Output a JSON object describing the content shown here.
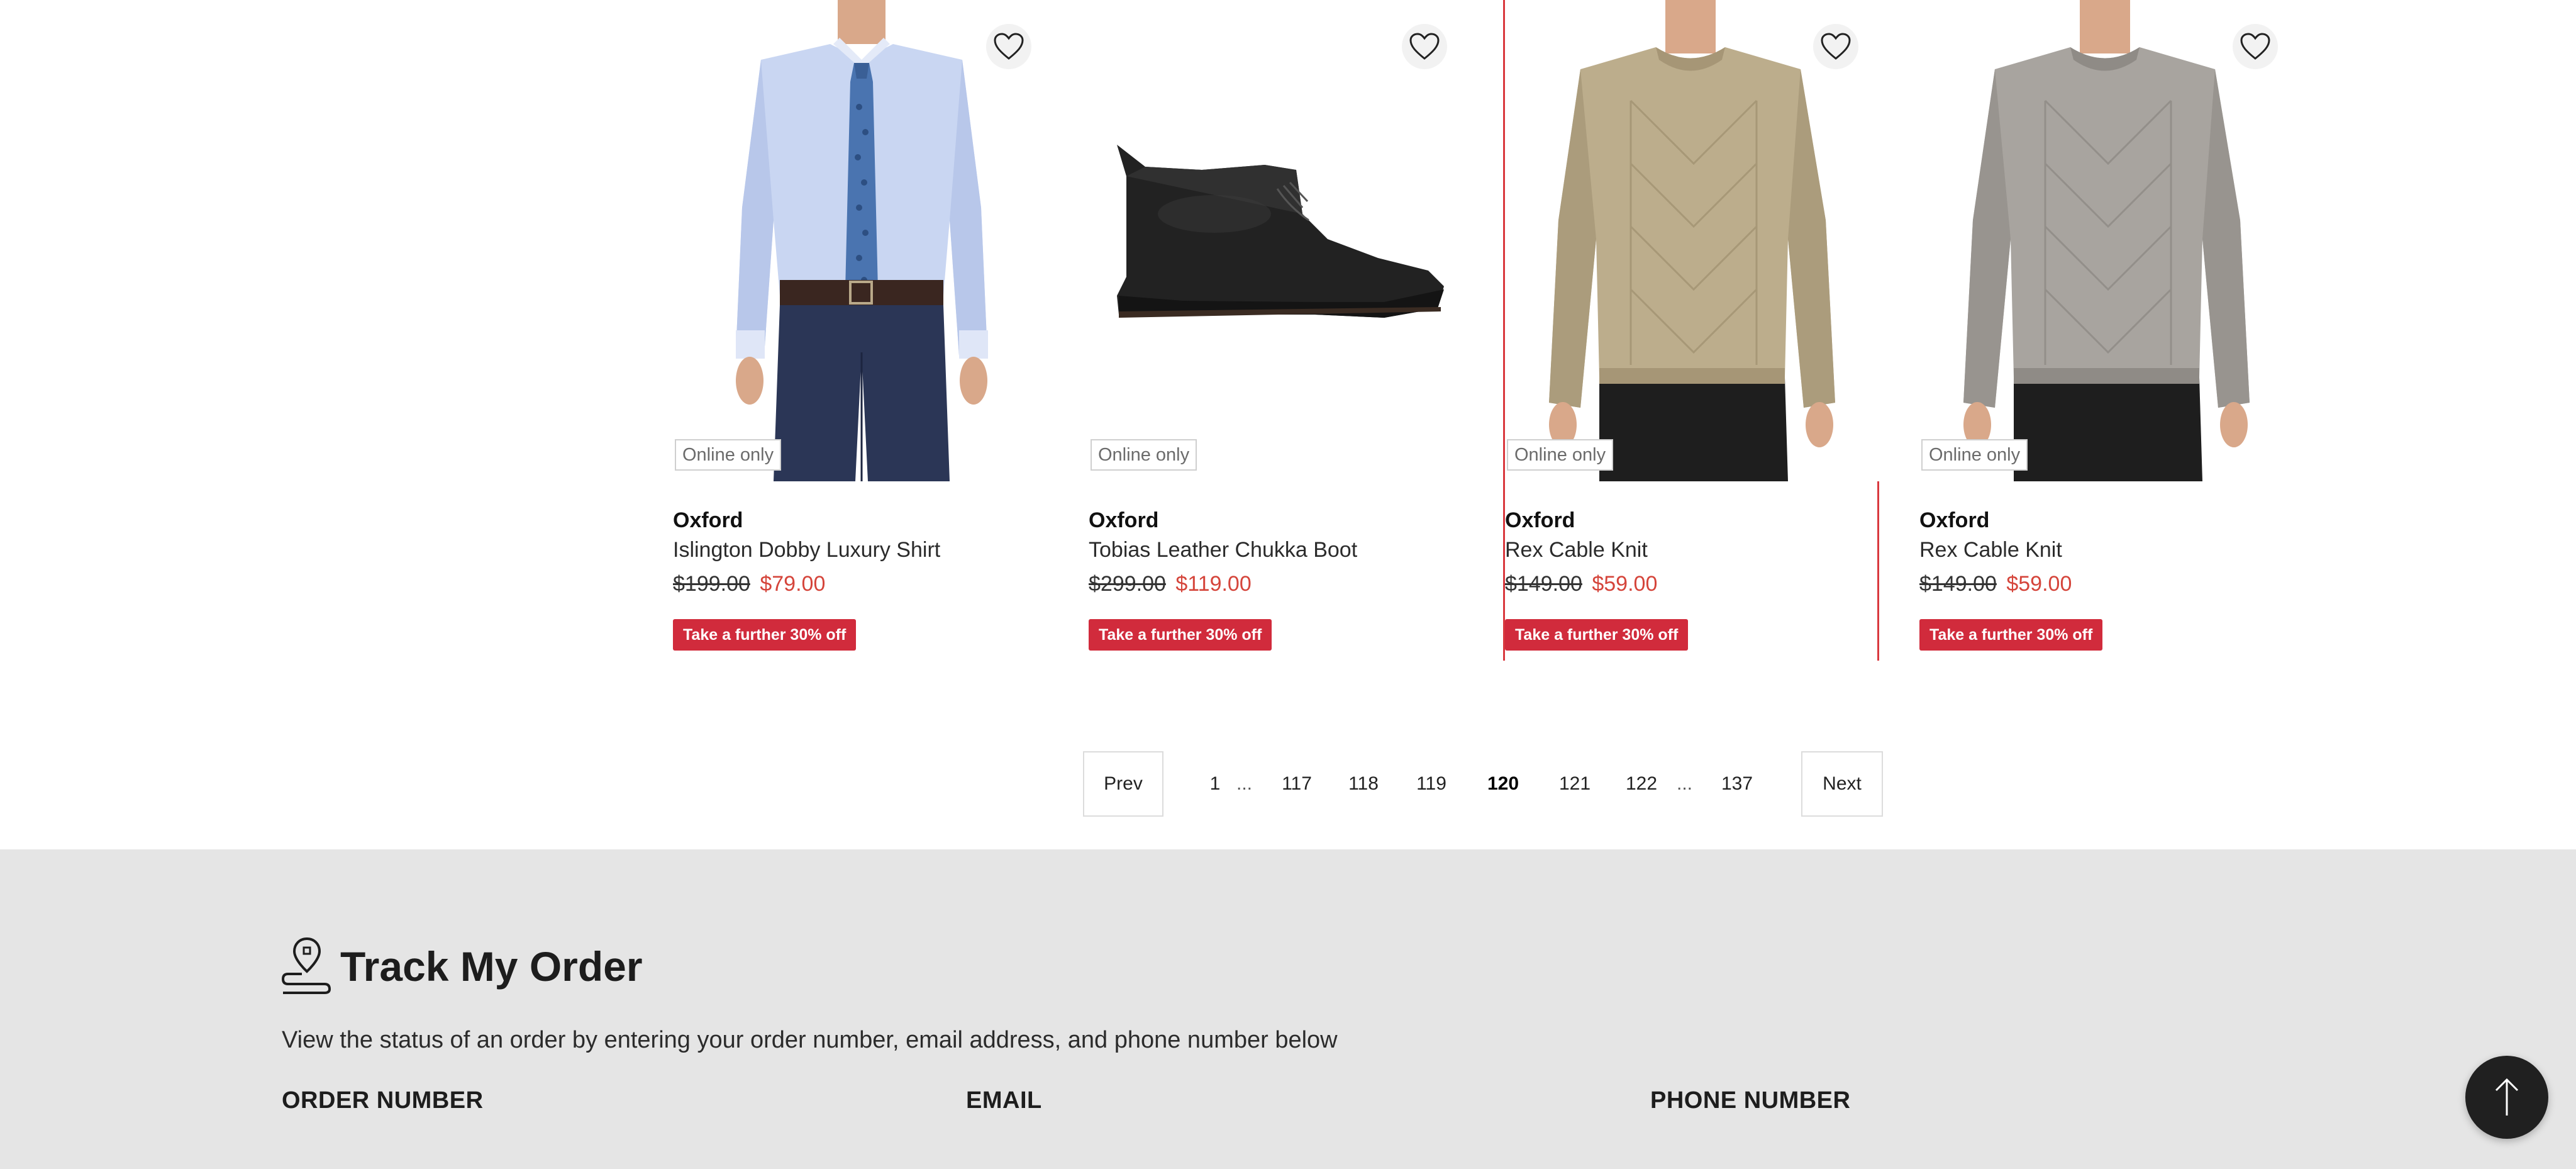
{
  "products": [
    {
      "image_alt": "shirt",
      "badge": "Online only",
      "brand": "Oxford",
      "name": "Islington Dobby Luxury Shirt",
      "price_was": "$199.00",
      "price_now": "$79.00",
      "promo": "Take a further 30% off"
    },
    {
      "image_alt": "boot",
      "badge": "Online only",
      "brand": "Oxford",
      "name": "Tobias Leather Chukka Boot",
      "price_was": "$299.00",
      "price_now": "$119.00",
      "promo": "Take a further 30% off"
    },
    {
      "image_alt": "knit-beige",
      "badge": "Online only",
      "brand": "Oxford",
      "name": "Rex Cable Knit",
      "price_was": "$149.00",
      "price_now": "$59.00",
      "promo": "Take a further 30% off"
    },
    {
      "image_alt": "knit-grey",
      "badge": "Online only",
      "brand": "Oxford",
      "name": "Rex Cable Knit",
      "price_was": "$149.00",
      "price_now": "$59.00",
      "promo": "Take a further 30% off"
    }
  ],
  "pagination": {
    "prev_label": "Prev",
    "next_label": "Next",
    "first": "1",
    "ellipsis": "...",
    "pages": [
      "117",
      "118",
      "119",
      "120",
      "121",
      "122"
    ],
    "current": "120",
    "last": "137"
  },
  "track_order": {
    "title": "Track My Order",
    "description": "View the status of an order by entering your order number, email address, and phone number below",
    "order_number_label": "ORDER NUMBER",
    "email_label": "EMAIL",
    "phone_label": "PHONE NUMBER",
    "order_number_value": "",
    "email_value": "",
    "phone_value": ""
  },
  "icons": {
    "wishlist": "heart-icon",
    "track": "location-pin-icon",
    "back_to_top": "arrow-up-icon"
  },
  "colors": {
    "sale_price": "#d5453b",
    "promo_badge": "#d12b3c",
    "highlight_border": "#d9383e",
    "footer_bg": "#e5e5e5"
  }
}
